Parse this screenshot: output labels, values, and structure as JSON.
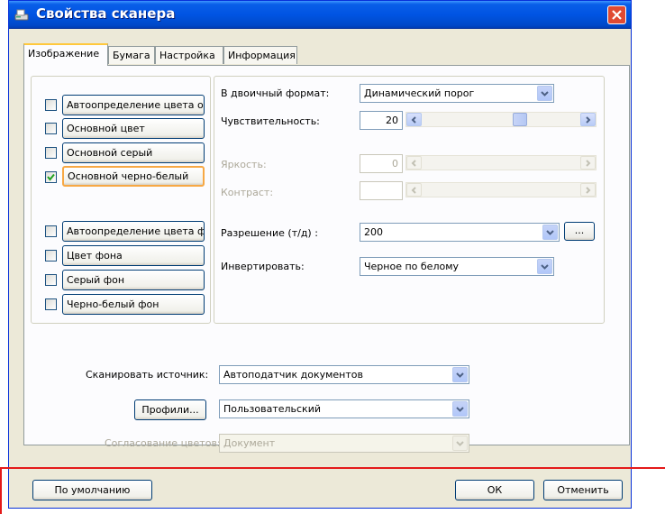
{
  "window": {
    "title": "Свойства сканера"
  },
  "tabs": [
    "Изображение",
    "Бумага",
    "Настройка",
    "Информация"
  ],
  "image_types": [
    {
      "label": "Автоопределение цвета осн",
      "checked": false
    },
    {
      "label": "Основной цвет",
      "checked": false
    },
    {
      "label": "Основной серый",
      "checked": false
    },
    {
      "label": "Основной черно-белый",
      "checked": true
    },
    {
      "label": "Автоопределение цвета фон",
      "checked": false
    },
    {
      "label": "Цвет фона",
      "checked": false
    },
    {
      "label": "Серый фон",
      "checked": false
    },
    {
      "label": "Черно-белый фон",
      "checked": false
    }
  ],
  "settings": {
    "binary_label": "В двоичный формат:",
    "binary_value": "Динамический порог",
    "sensitivity_label": "Чувствительность:",
    "sensitivity_value": "20",
    "brightness_label": "Яркость:",
    "brightness_value": "0",
    "contrast_label": "Контраст:",
    "resolution_label": "Разрешение (т/д) :",
    "resolution_value": "200",
    "resolution_more": "...",
    "invert_label": "Инвертировать:",
    "invert_value": "Черное по белому"
  },
  "source": {
    "label": "Сканировать источник:",
    "value": "Автоподатчик документов",
    "profiles_button": "Профили...",
    "profile_value": "Пользовательский",
    "color_match_label": "Согласование цветов:",
    "color_match_value": "Документ"
  },
  "buttons": {
    "default": "По умолчанию",
    "ok": "ОК",
    "cancel": "Отменить"
  },
  "colors": {
    "titlebar": "#0054E3",
    "highlight_border": "#E41A1A",
    "focus_border": "#F7A844"
  }
}
